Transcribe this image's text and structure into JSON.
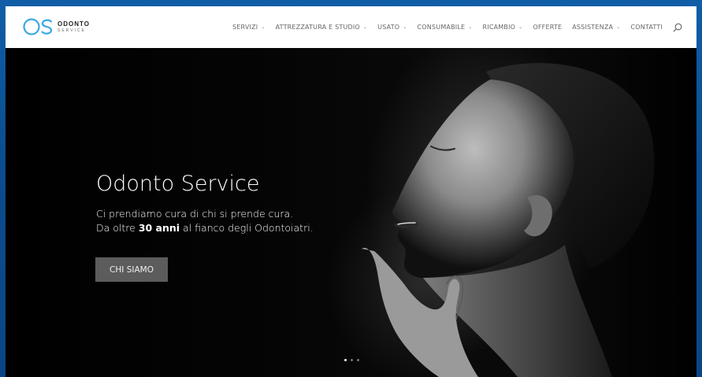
{
  "brand": {
    "name": "ODONTO",
    "tagline": "SERVICE",
    "logo_icon": "os-logo-icon",
    "accent_color": "#3aa7e0"
  },
  "nav": {
    "items": [
      {
        "label": "SERVIZI",
        "has_dropdown": true
      },
      {
        "label": "ATTREZZATURA E STUDIO",
        "has_dropdown": true
      },
      {
        "label": "USATO",
        "has_dropdown": true
      },
      {
        "label": "CONSUMABILE",
        "has_dropdown": true
      },
      {
        "label": "RICAMBIO",
        "has_dropdown": true
      },
      {
        "label": "OFFERTE",
        "has_dropdown": false
      },
      {
        "label": "ASSISTENZA",
        "has_dropdown": true
      },
      {
        "label": "CONTATTI",
        "has_dropdown": false
      }
    ],
    "search_icon": "search-icon"
  },
  "hero": {
    "title": "Odonto Service",
    "line1": "Ci prendiamo cura di chi si prende cura.",
    "line2_prefix": "Da oltre ",
    "line2_bold": "30 anni",
    "line2_suffix": " al fianco degli Odontoiatri.",
    "cta_label": "CHI SIAMO",
    "slides_count": 3,
    "active_slide": 1
  }
}
